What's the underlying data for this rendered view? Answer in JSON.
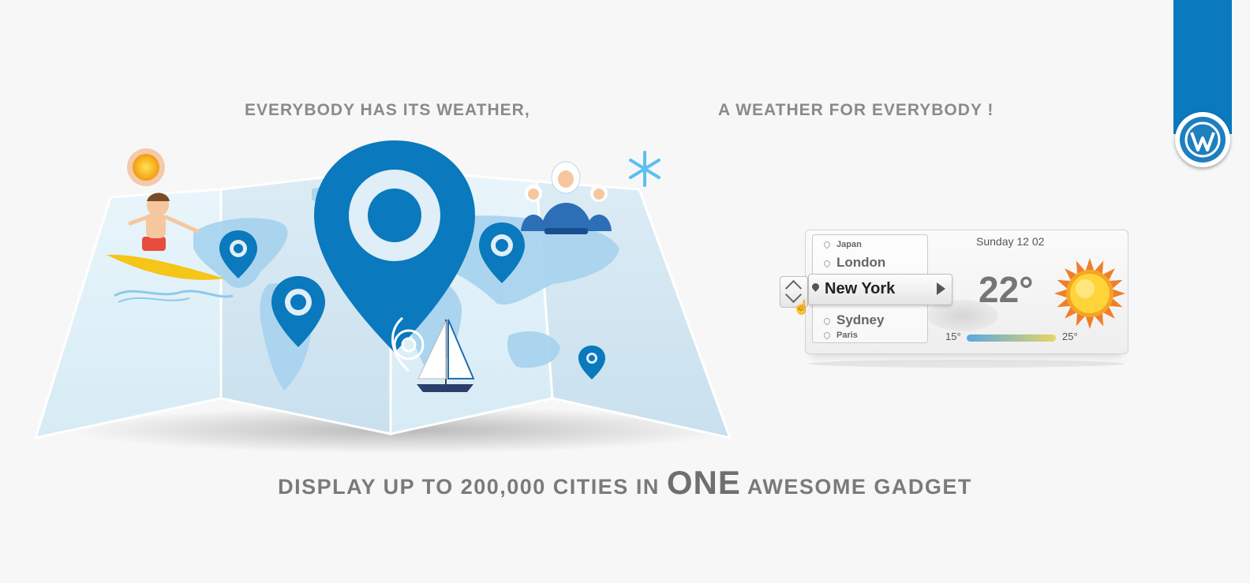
{
  "header": {
    "tagline_left": "EVERYBODY HAS ITS WEATHER,",
    "tagline_right": "A WEATHER FOR EVERYBODY !"
  },
  "footer": {
    "pre": "DISPLAY UP TO 200,000 CITIES IN ",
    "emphasis": "ONE",
    "post": " AWESOME GADGET"
  },
  "widget": {
    "date": "Sunday 12 02",
    "temperature": "22°",
    "temp_min": "15°",
    "temp_max": "25°",
    "cities": [
      "Japan",
      "London",
      "New York",
      "Sydney",
      "Paris"
    ],
    "selected_city": "New York"
  },
  "colors": {
    "brand_blue": "#0a79bd",
    "map_blue": "#a8d3ee",
    "text_gray": "#8a8a8a"
  },
  "icons": [
    "wordpress-icon",
    "location-pin-icon",
    "sun-icon",
    "snowflake-icon",
    "cursor-hand-icon"
  ]
}
